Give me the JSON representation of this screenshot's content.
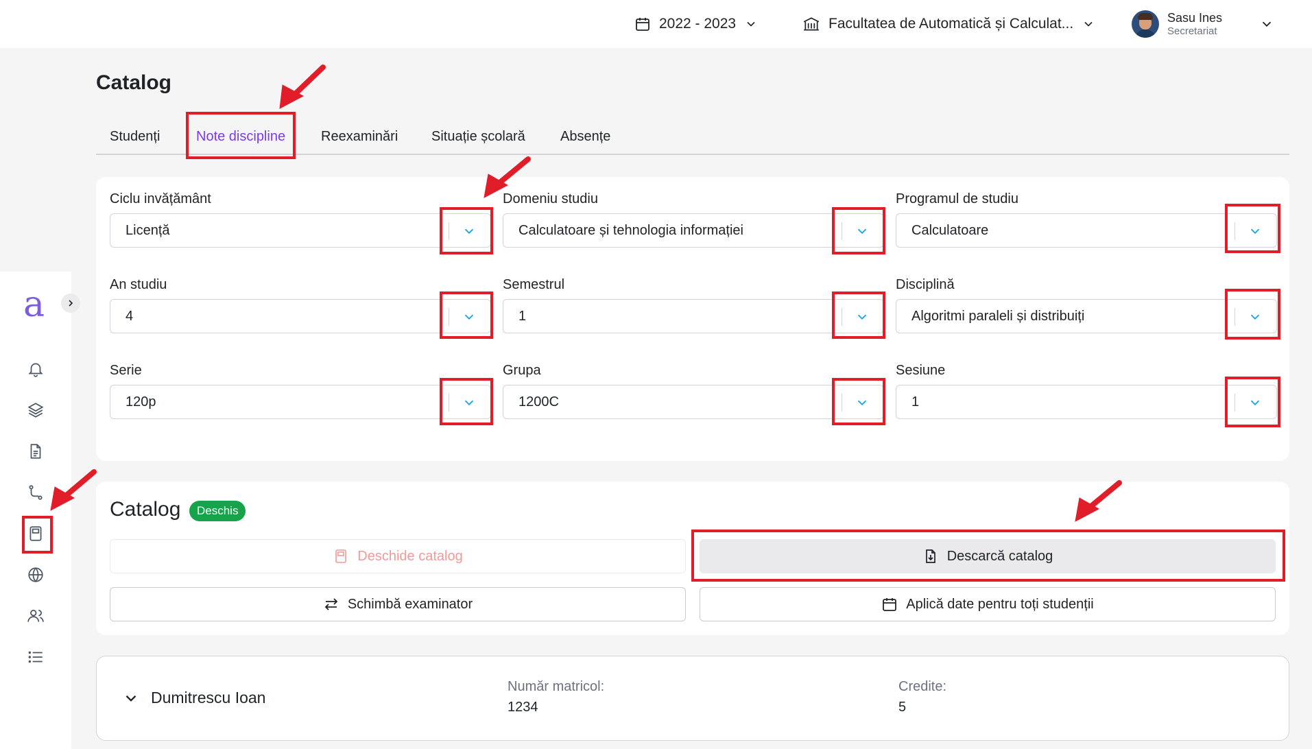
{
  "topbar": {
    "academic_year": "2022 - 2023",
    "faculty": "Facultatea de Automatică și Calculat...",
    "user_name": "Sasu Ines",
    "user_role": "Secretariat"
  },
  "sidebar": {
    "logo": "a",
    "icons": [
      "bell-icon",
      "layers-icon",
      "document-icon",
      "route-icon",
      "book-icon",
      "globe-icon",
      "users-icon",
      "list-icon"
    ],
    "active_icon": "book-icon"
  },
  "page": {
    "title": "Catalog"
  },
  "tabs": [
    {
      "label": "Studenți"
    },
    {
      "label": "Note discipline"
    },
    {
      "label": "Reexaminări"
    },
    {
      "label": "Situație școlară"
    },
    {
      "label": "Absențe"
    }
  ],
  "active_tab": "Note discipline",
  "filters": {
    "ciclu": {
      "label": "Ciclu invățământ",
      "value": "Licență"
    },
    "domeniu": {
      "label": "Domeniu studiu",
      "value": "Calculatoare și tehnologia informației"
    },
    "program": {
      "label": "Programul de studiu",
      "value": "Calculatoare"
    },
    "an": {
      "label": "An studiu",
      "value": "4"
    },
    "semestru": {
      "label": "Semestrul",
      "value": "1"
    },
    "disciplina": {
      "label": "Disciplină",
      "value": "Algoritmi paraleli și distribuiți"
    },
    "serie": {
      "label": "Serie",
      "value": "120p"
    },
    "grupa": {
      "label": "Grupa",
      "value": "1200C"
    },
    "sesiune": {
      "label": "Sesiune",
      "value": "1"
    }
  },
  "catalog": {
    "title": "Catalog",
    "status_badge": "Deschis",
    "open_label": "Deschide catalog",
    "download_label": "Descarcă catalog",
    "change_examiner_label": "Schimbă examinator",
    "apply_dates_label": "Aplică date pentru toți studenții"
  },
  "student": {
    "name": "Dumitrescu Ioan",
    "matricol_label": "Număr matricol:",
    "matricol_value": "1234",
    "credits_label": "Credite:",
    "credits_value": "5"
  },
  "colors": {
    "accent": "#7c3aed",
    "badge": "#16a34a",
    "annotation": "#e11d2a",
    "disabled_text": "#f19a98"
  }
}
